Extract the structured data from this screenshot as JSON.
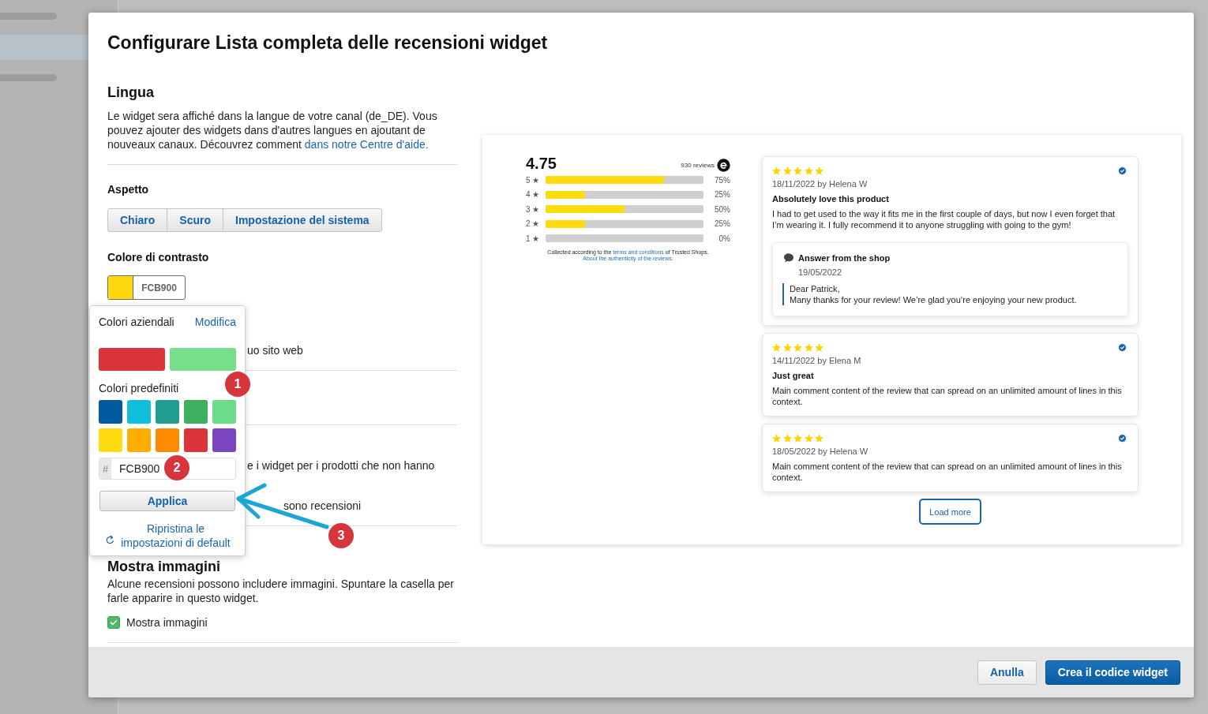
{
  "dialog": {
    "title": "Configurare Lista completa delle recensioni widget"
  },
  "language": {
    "heading": "Lingua",
    "text": "Le widget sera affiché dans la langue de votre canal (de_DE). Vous pouvez ajouter des widgets dans d'autres langues en ajoutant de nouveaux canaux. Découvrez comment ",
    "link": "dans notre Centre d'aide."
  },
  "appearance": {
    "heading": "Aspetto",
    "options": [
      {
        "label": "Chiaro",
        "selected": false
      },
      {
        "label": "Scuro",
        "selected": false
      },
      {
        "label": "Impostazione del sistema",
        "selected": false
      }
    ]
  },
  "contrast_color": {
    "heading": "Colore di contrasto",
    "color": "#ffd90f",
    "value": "FCB900"
  },
  "covered_sections": [
    {
      "lines": [
        "uo sito web"
      ]
    },
    {
      "lines": [
        "e i widget per i prodotti che non hanno",
        "sono recensioni"
      ]
    }
  ],
  "images": {
    "heading": "Mostra immagini",
    "text": "Alcune recensioni possono includere immagini. Spuntare la casella per farle apparire in questo widget.",
    "checkbox": {
      "label": "Mostra immagini",
      "checked": true
    }
  },
  "color_picker": {
    "company_heading": "Colori aziendali",
    "edit_link": "Modifica",
    "company_colors": [
      {
        "color": "#d9353a"
      },
      {
        "color": "#77df8b"
      }
    ],
    "preset_heading": "Colori predefiniti",
    "preset_colors": [
      {
        "color": "#005aa0"
      },
      {
        "color": "#0fbfdd"
      },
      {
        "color": "#1f9e90"
      },
      {
        "color": "#3daf5e"
      },
      {
        "color": "#6cdc8a"
      },
      {
        "color": "#ffdc0f"
      },
      {
        "color": "#ffae00"
      },
      {
        "color": "#ff8c00"
      },
      {
        "color": "#d9353a"
      },
      {
        "color": "#7b45c2"
      }
    ],
    "hex_prefix": "#",
    "hex_value": "FCB900",
    "apply_button": "Applica",
    "reset_link": "Ripristina le impostazioni di default"
  },
  "annotations": [
    {
      "label": "1"
    },
    {
      "label": "2"
    },
    {
      "label": "3"
    }
  ],
  "preview": {
    "summary": {
      "average": "4.75",
      "count": "930 reviews",
      "rows": [
        {
          "label": "5 ★",
          "level": 0.75,
          "percent": "75%"
        },
        {
          "label": "4 ★",
          "level": 0.25,
          "percent": "25%"
        },
        {
          "label": "3 ★",
          "level": 0.5,
          "percent": "50%"
        },
        {
          "label": "2 ★",
          "level": 0.25,
          "percent": "25%"
        },
        {
          "label": "1 ★",
          "level": 0,
          "percent": "0%"
        }
      ],
      "note_prefix": "Collected according to the ",
      "note_link": "terms and conditions",
      "note_suffix": " of Trusted Shops.",
      "authenticity_link": "About the authenticity of the reviews",
      "authenticity_suffix": "."
    },
    "reviews": [
      {
        "stars": 5,
        "verified": true,
        "meta": "18/11/2022 by Helena W",
        "title": "Absolutely love this product",
        "body": "I had to get used to the way it fits me in the first couple of days, but now I even forget that I’m wearing it. I fully recommend it to anyone struggling with going to the gym!",
        "reply": {
          "heading": "Answer from the shop",
          "date": "19/05/2022",
          "lines": [
            "Dear Patrick,",
            "Many thanks for your review! We’re glad you’re enjoying your new product."
          ]
        }
      },
      {
        "stars": 5,
        "verified": true,
        "meta": "14/11/2022 by Elena M",
        "title": "Just great",
        "body": "Main comment content of the review that can spread on an unlimited amount of lines in this context."
      },
      {
        "stars": 5,
        "verified": true,
        "meta": "18/05/2022 by Helena W",
        "body": "Main comment content of the review that can spread on an unlimited amount of lines in this context."
      }
    ],
    "load_more_button": "Load more"
  },
  "footer": {
    "buttons": [
      {
        "label": "Anulla",
        "kind": "secondary"
      },
      {
        "label": "Crea il codice widget",
        "kind": "primary"
      }
    ]
  }
}
